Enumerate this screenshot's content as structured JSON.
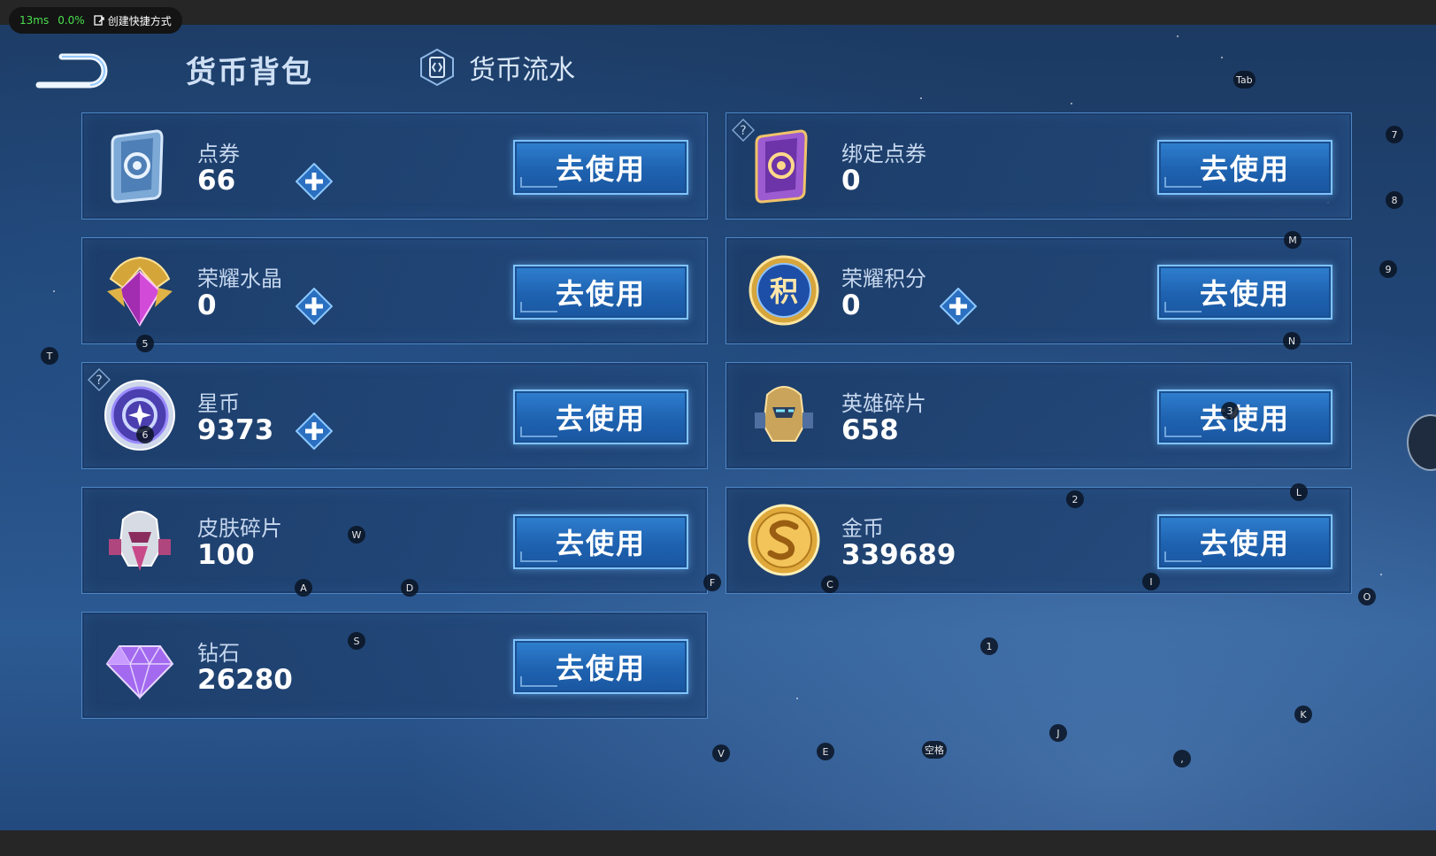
{
  "status_bar": {
    "latency": "13ms",
    "percent": "0.0%",
    "shortcut_label": "创建快捷方式"
  },
  "header": {
    "title": "货币背包",
    "flow_tab_label": "货币流水"
  },
  "currencies": [
    {
      "name": "点券",
      "amount": "66",
      "button": "去使用",
      "icon": "voucher-blue-icon"
    },
    {
      "name": "绑定点券",
      "amount": "0",
      "button": "去使用",
      "icon": "bound-voucher-purple-icon"
    },
    {
      "name": "荣耀水晶",
      "amount": "0",
      "button": "去使用",
      "icon": "glory-crystal-icon"
    },
    {
      "name": "荣耀积分",
      "amount": "0",
      "button": "去使用",
      "icon": "glory-points-icon"
    },
    {
      "name": "星币",
      "amount": "9373",
      "button": "去使用",
      "icon": "star-coin-icon"
    },
    {
      "name": "英雄碎片",
      "amount": "658",
      "button": "去使用",
      "icon": "hero-fragment-icon"
    },
    {
      "name": "皮肤碎片",
      "amount": "100",
      "button": "去使用",
      "icon": "skin-fragment-icon"
    },
    {
      "name": "金币",
      "amount": "339689",
      "button": "去使用",
      "icon": "gold-coin-icon"
    },
    {
      "name": "钻石",
      "amount": "26280",
      "button": "去使用",
      "icon": "diamond-icon"
    }
  ],
  "glyphs": {
    "plus": "+",
    "help": "?",
    "emblem_char": "积"
  },
  "key_hints": [
    "Tab",
    "7",
    "8",
    "M",
    "9",
    "T",
    "5",
    "N",
    "6",
    "3",
    "2",
    "L",
    "W",
    "A",
    "D",
    "F",
    "C",
    "I",
    "O",
    "S",
    "1",
    "K",
    "V",
    "E",
    "空格",
    "J",
    ","
  ],
  "colors": {
    "button_blue": "#1e62b0",
    "card_border": "#4d86c4",
    "latency_green": "#49e04d"
  }
}
